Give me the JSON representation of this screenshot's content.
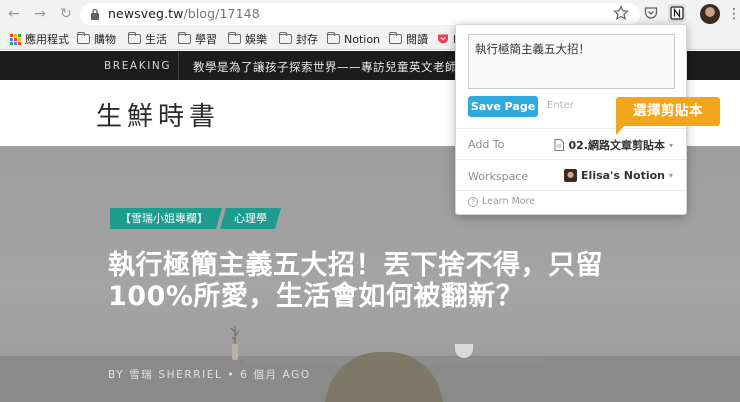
{
  "browser": {
    "url_domain": "newsveg.tw",
    "url_path": "/blog/17148",
    "bookmarks": [
      {
        "label": "應用程式"
      },
      {
        "label": "購物"
      },
      {
        "label": "生活"
      },
      {
        "label": "學習"
      },
      {
        "label": "娛樂"
      },
      {
        "label": "封存"
      },
      {
        "label": "Notion"
      },
      {
        "label": "閱讀"
      },
      {
        "label": "R"
      }
    ]
  },
  "site": {
    "breaking_label": "BREAKING",
    "breaking_text": "教學是為了讓孩子探索世界——專訪兒童英文老師ARIEL",
    "logo": "生鮮時書",
    "tags": [
      "【雪瑞小姐專欄】",
      "心理學"
    ],
    "title": "執行極簡主義五大招！丟下捨不得，只留100%所愛，生活會如何被翻新？",
    "byline": "BY 雪瑞 SHERRIEL  •  6 個月 AGO"
  },
  "clipper": {
    "page_title": "執行極簡主義五大招！",
    "save_button": "Save Page",
    "enter_hint": "Enter",
    "add_to_label": "Add To",
    "add_to_value": "02.網路文章剪貼本",
    "workspace_label": "Workspace",
    "workspace_value": "Elisa's Notion",
    "learn_more": "Learn More"
  },
  "annotation": {
    "callout": "選擇剪貼本"
  }
}
